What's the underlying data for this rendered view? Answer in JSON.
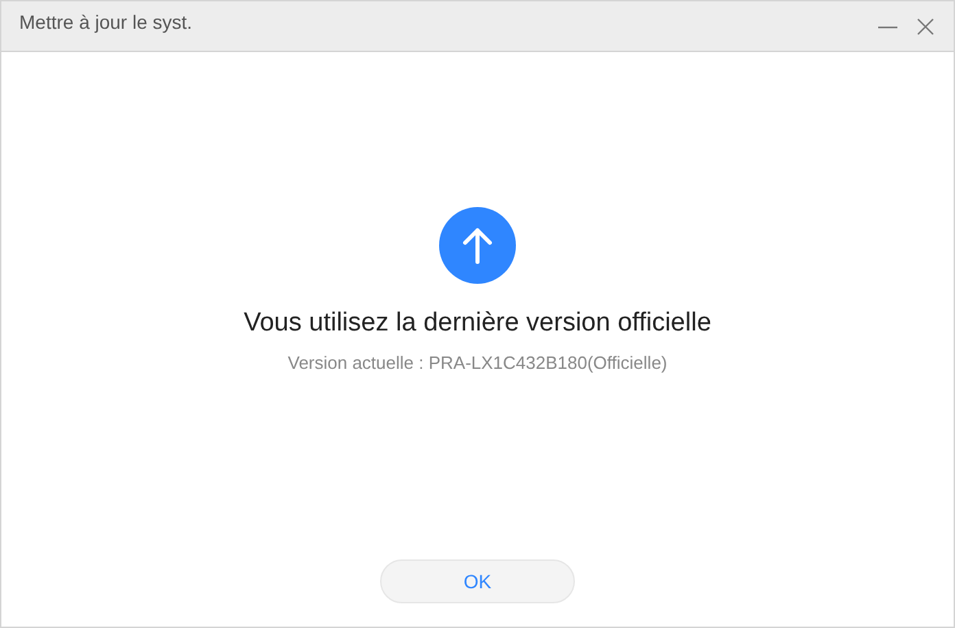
{
  "window": {
    "title": "Mettre à jour le syst."
  },
  "message": {
    "heading": "Vous utilisez la dernière version officielle",
    "detail": "Version actuelle : PRA-LX1C432B180(Officielle)"
  },
  "buttons": [
    "OK"
  ]
}
